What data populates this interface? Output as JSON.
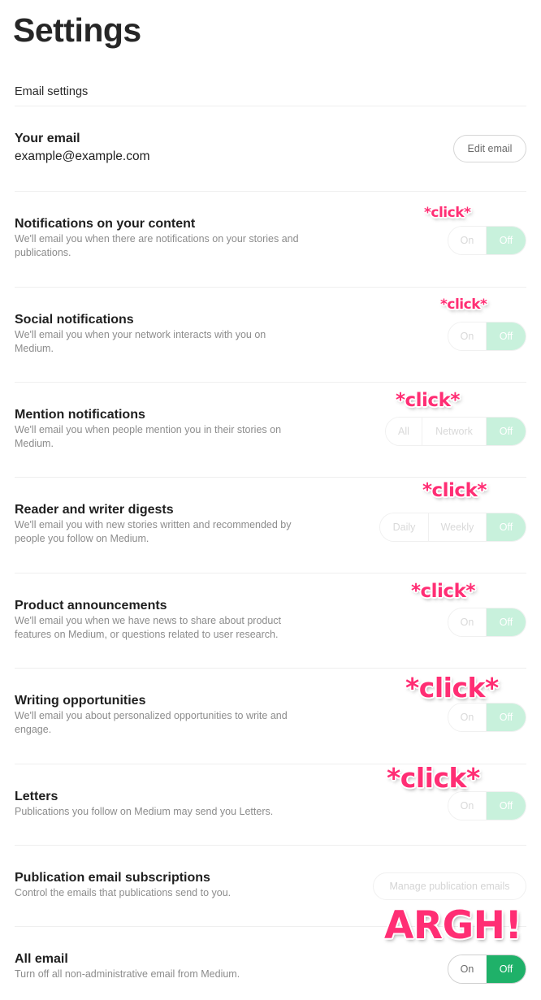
{
  "page_title": "Settings",
  "section_label": "Email settings",
  "email_row": {
    "title": "Your email",
    "value": "example@example.com",
    "edit_label": "Edit email"
  },
  "rows": {
    "notifications_content": {
      "title": "Notifications on your content",
      "desc": "We'll email you when there are notifications on your stories and publications.",
      "options": [
        "On",
        "Off"
      ],
      "selected": "Off"
    },
    "social": {
      "title": "Social notifications",
      "desc": "We'll email you when your network interacts with you on Medium.",
      "options": [
        "On",
        "Off"
      ],
      "selected": "Off"
    },
    "mention": {
      "title": "Mention notifications",
      "desc": "We'll email you when people mention you in their stories on Medium.",
      "options": [
        "All",
        "Network",
        "Off"
      ],
      "selected": "Off"
    },
    "digests": {
      "title": "Reader and writer digests",
      "desc": "We'll email you with new stories written and recommended by people you follow on Medium.",
      "options": [
        "Daily",
        "Weekly",
        "Off"
      ],
      "selected": "Off"
    },
    "product": {
      "title": "Product announcements",
      "desc": "We'll email you when we have news to share about product features on Medium, or questions related to user research.",
      "options": [
        "On",
        "Off"
      ],
      "selected": "Off"
    },
    "writing": {
      "title": "Writing opportunities",
      "desc": "We'll email you about personalized opportunities to write and engage.",
      "options": [
        "On",
        "Off"
      ],
      "selected": "Off"
    },
    "letters": {
      "title": "Letters",
      "desc": "Publications you follow on Medium may send you Letters.",
      "options": [
        "On",
        "Off"
      ],
      "selected": "Off"
    },
    "publication": {
      "title": "Publication email subscriptions",
      "desc": "Control the emails that publications send to you.",
      "button_label": "Manage publication emails"
    },
    "all_email": {
      "title": "All email",
      "desc": "Turn off all non-administrative email from Medium.",
      "options": [
        "On",
        "Off"
      ],
      "selected": "Off"
    }
  },
  "annotations": {
    "click_label": "*click*",
    "argh_label": "ARGH!",
    "color": "#ff2e74"
  },
  "colors": {
    "accent_green": "#1fb169",
    "faded_green": "#c8f1dc"
  }
}
